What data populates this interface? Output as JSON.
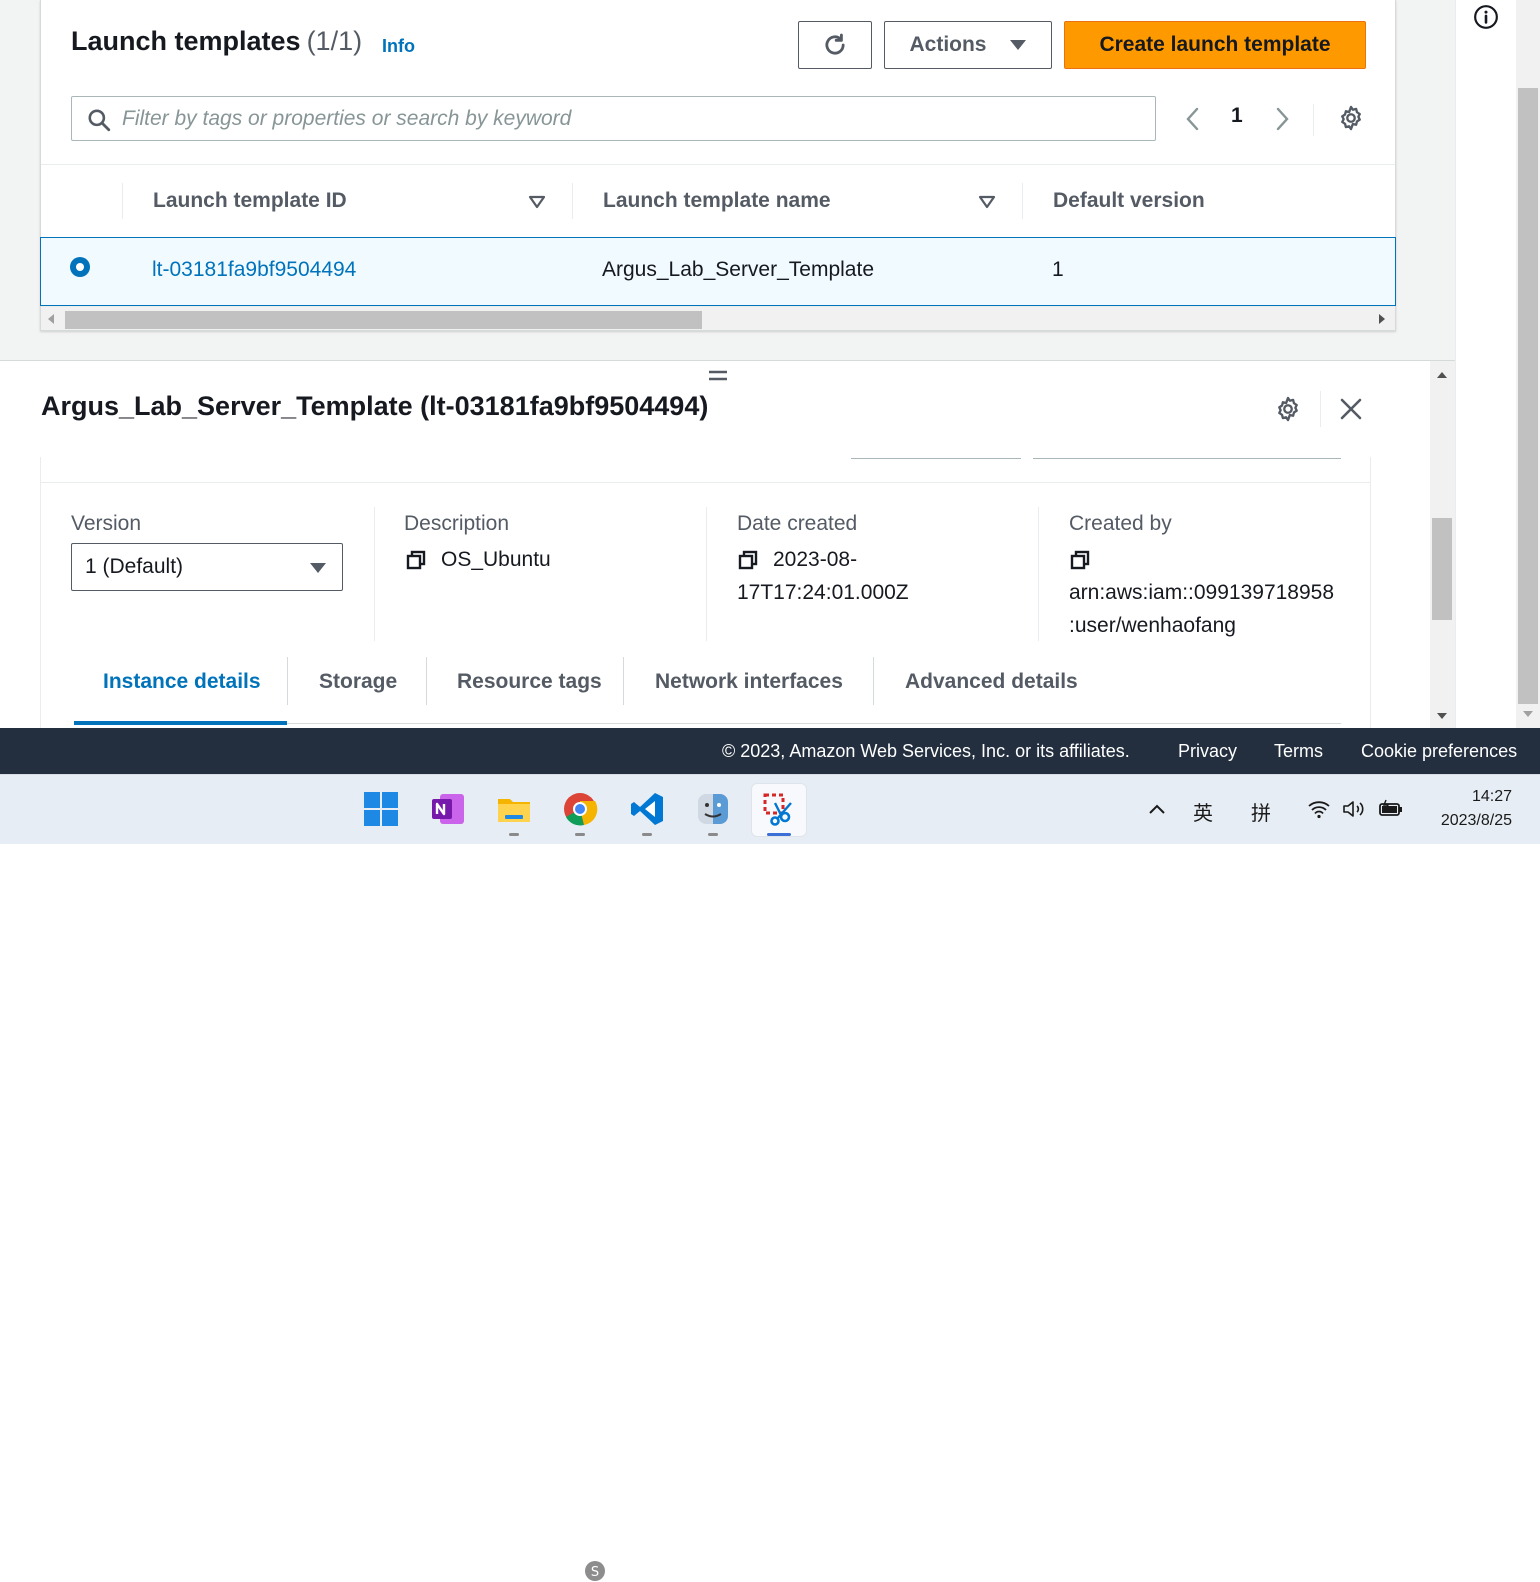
{
  "launch_templates": {
    "title": "Launch templates",
    "count": "(1/1)",
    "info_link": "Info",
    "actions_label": "Actions",
    "create_label": "Create launch template",
    "search_placeholder": "Filter by tags or properties or search by keyword",
    "page_number": "1",
    "columns": [
      "Launch template ID",
      "Launch template name",
      "Default version"
    ],
    "rows": [
      {
        "id": "lt-03181fa9bf9504494",
        "name": "Argus_Lab_Server_Template",
        "default_version": "1",
        "selected": true
      }
    ]
  },
  "detail": {
    "title": "Argus_Lab_Server_Template (lt-03181fa9bf9504494)",
    "version_label": "Version",
    "version_value": "1 (Default)",
    "description_label": "Description",
    "description_value": "OS_Ubuntu",
    "date_created_label": "Date created",
    "date_created_line1": "2023-08-",
    "date_created_line2": "17T17:24:01.000Z",
    "created_by_label": "Created by",
    "created_by_line1": "arn:aws:iam::099139718958",
    "created_by_line2": ":user/wenhaofang",
    "tabs": [
      "Instance details",
      "Storage",
      "Resource tags",
      "Network interfaces",
      "Advanced details"
    ],
    "active_tab": "Instance details"
  },
  "footer": {
    "copyright": "© 2023, Amazon Web Services, Inc. or its affiliates.",
    "privacy": "Privacy",
    "terms": "Terms",
    "cookie": "Cookie preferences"
  },
  "taskbar": {
    "apps": [
      "windows-start",
      "onenote",
      "file-explorer",
      "chrome",
      "vscode",
      "finder",
      "snipping-tool"
    ],
    "ime_lang": "英",
    "ime_mode": "拼",
    "time": "14:27",
    "date": "2023/8/25"
  },
  "colors": {
    "accent": "#0073bb",
    "primary_button": "#ff9900",
    "footer_bg": "#232f3e",
    "selected_row_bg": "#f1faff"
  }
}
